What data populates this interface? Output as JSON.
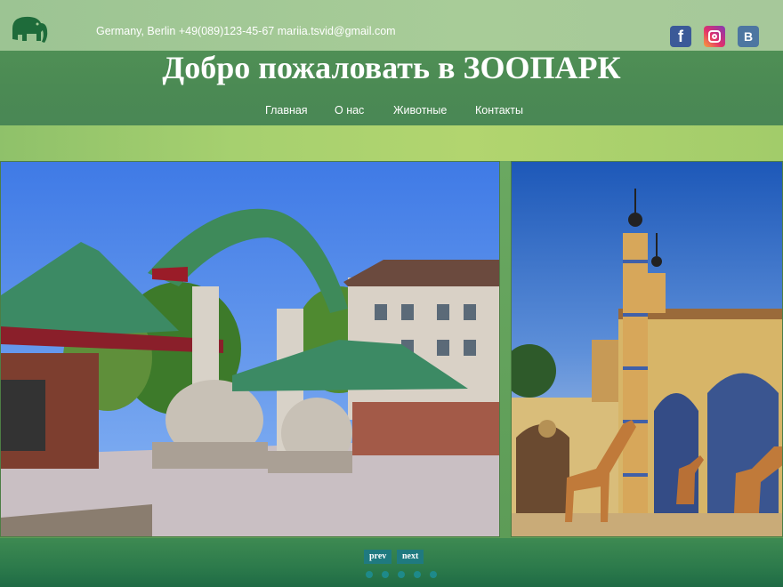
{
  "topbar": {
    "logo_icon": "elephant-icon",
    "contact_text": "Germany, Berlin +49(089)123-45-67 mariia.tsvid@gmail.com",
    "social": [
      {
        "name": "facebook-icon",
        "glyph": "f"
      },
      {
        "name": "instagram-icon",
        "glyph": ""
      },
      {
        "name": "vk-icon",
        "glyph": "B"
      }
    ]
  },
  "header": {
    "title": "Добро пожаловать в ЗООПАРК",
    "nav": [
      "Главная",
      "О нас",
      "Животные",
      "Контакты"
    ]
  },
  "slider": {
    "slides": [
      "zoo-gate-photo",
      "giraffe-house-photo"
    ],
    "prev_label": "prev",
    "next_label": "next",
    "dot_count": 5
  },
  "colors": {
    "topbar": "#a8cc98",
    "header": "#4b8a54",
    "strip": "#a6d06f",
    "button": "#1f7a80"
  }
}
